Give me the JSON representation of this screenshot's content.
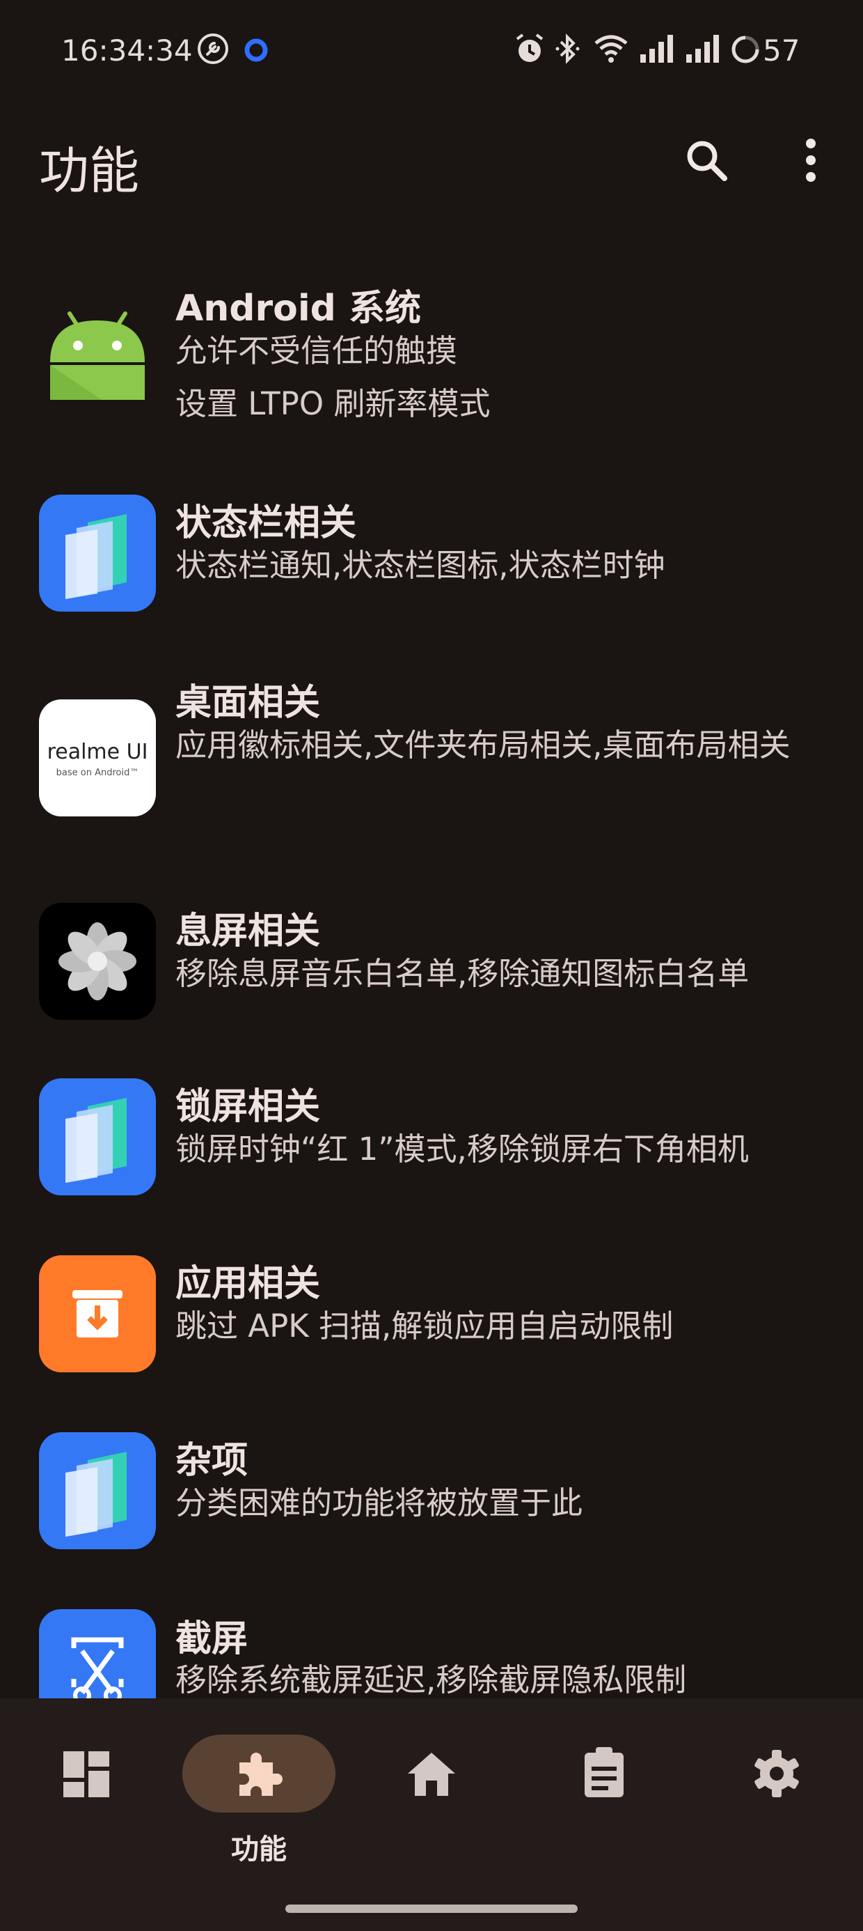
{
  "status_bar": {
    "time": "16:34:34",
    "battery": "57",
    "icons": [
      "wrench-icon",
      "record-icon",
      "alarm-icon",
      "bluetooth-icon",
      "wifi-icon",
      "signal-icon",
      "signal-icon",
      "battery-icon"
    ]
  },
  "app_bar": {
    "title": "功能",
    "actions": [
      "search-icon",
      "more-vert-icon"
    ]
  },
  "items": [
    {
      "icon": "android-icon",
      "title": "Android 系统",
      "subtitle": "允许不受信任的触摸\n设置 LTPO 刷新率模式"
    },
    {
      "icon": "systemui-icon",
      "title": "状态栏相关",
      "subtitle": "状态栏通知,状态栏图标,状态栏时钟"
    },
    {
      "icon": "realme-ui-icon",
      "title": "桌面相关",
      "subtitle": "应用徽标相关,文件夹布局相关,桌面布局相关",
      "icon_text": "realme UI",
      "icon_subtext": "base on Android™"
    },
    {
      "icon": "aod-flower-icon",
      "title": "息屏相关",
      "subtitle": "移除息屏音乐白名单,移除通知图标白名单"
    },
    {
      "icon": "systemui-icon",
      "title": "锁屏相关",
      "subtitle": "锁屏时钟“红 1”模式,移除锁屏右下角相机"
    },
    {
      "icon": "package-install-icon",
      "title": "应用相关",
      "subtitle": "跳过 APK 扫描,解锁应用自启动限制"
    },
    {
      "icon": "systemui-icon",
      "title": "杂项",
      "subtitle": "分类困难的功能将被放置于此"
    },
    {
      "icon": "screenshot-scissors-icon",
      "title": "截屏",
      "subtitle": "移除系统截屏延迟,移除截屏隐私限制"
    }
  ],
  "bottom_nav": {
    "items": [
      {
        "icon": "dashboard-icon",
        "label": ""
      },
      {
        "icon": "extension-icon",
        "label": "功能",
        "active": true
      },
      {
        "icon": "home-icon",
        "label": ""
      },
      {
        "icon": "clipboard-icon",
        "label": ""
      },
      {
        "icon": "settings-gear-icon",
        "label": ""
      }
    ]
  },
  "colors": {
    "background": "#1a1413",
    "nav_background": "#231c1a",
    "active_pill": "#5a4232",
    "android_green": "#8cc84b",
    "systemui_blue": "#3478f6",
    "app_orange": "#ff7a29"
  }
}
